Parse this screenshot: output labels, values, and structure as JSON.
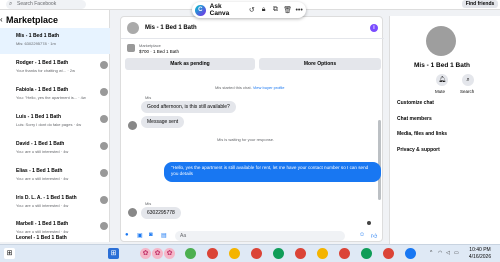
{
  "topbar": {
    "search_placeholder": "Search Facebook",
    "find_friends": "Find friends"
  },
  "canva_bar": {
    "label": "Ask Canva"
  },
  "sidebar": {
    "title": "Marketplace",
    "conversations": [
      {
        "name": "Mis - 1 Bed 1 Bath",
        "preview": "Mis: 6302295778 · 1m"
      },
      {
        "name": "Rodger - 1 Bed 1 Bath",
        "preview": "Your thanks for chatting w/...  · 2w"
      },
      {
        "name": "Fabiola - 1 Bed 1 Bath",
        "preview": "You: \"Hello, yes the apartment is...  · 4w"
      },
      {
        "name": "Luis - 1 Bed 1 Bath",
        "preview": "Luis: Sorry I dont do fake pages · 4w"
      },
      {
        "name": "David - 1 Bed 1 Bath",
        "preview": "You: are u still interested · 4w"
      },
      {
        "name": "Elias - 1 Bed 1 Bath",
        "preview": "You: are u still interested · 4w"
      },
      {
        "name": "Iris D. L. A. - 1 Bed 1 Bath",
        "preview": "You: are u still interested · 4w"
      },
      {
        "name": "Marbell - 1 Bed 1 Bath",
        "preview": "You: are u still interested · 4w"
      },
      {
        "name": "Leonel - 1 Bed 1 Bath",
        "preview": ""
      }
    ]
  },
  "chat": {
    "title": "Mis - 1 Bed 1 Bath",
    "listing_label": "Marketplace",
    "listing_line": "$700 · 1 Bed 1 Bath",
    "mark_pending": "Mark as pending",
    "more_options": "More Options",
    "system_started": "Mis started this chat.",
    "view_profile": "View buyer profile",
    "sender1": "Mis",
    "msg1": "Good afternoon, is this still available?",
    "msg_sent": "Message sent",
    "system_waiting": "Mis is waiting for your response.",
    "outgoing": "\"Hello, yes the apartment is still available for rent, let me have your contact number so I can send you details",
    "sender2": "Mis",
    "msg2": "6302295778",
    "composer_placeholder": "Aa"
  },
  "right_panel": {
    "name": "Mis - 1 Bed 1 Bath",
    "mute": "Mute",
    "search": "Search",
    "items": [
      "Customize chat",
      "Chat members",
      "Media, files and links",
      "Privacy & support"
    ]
  },
  "taskbar": {
    "time": "10:40 PM",
    "date": "4/16/2026"
  },
  "colors": {
    "accent": "#1877f2",
    "info_badge": "#7a4cff"
  }
}
